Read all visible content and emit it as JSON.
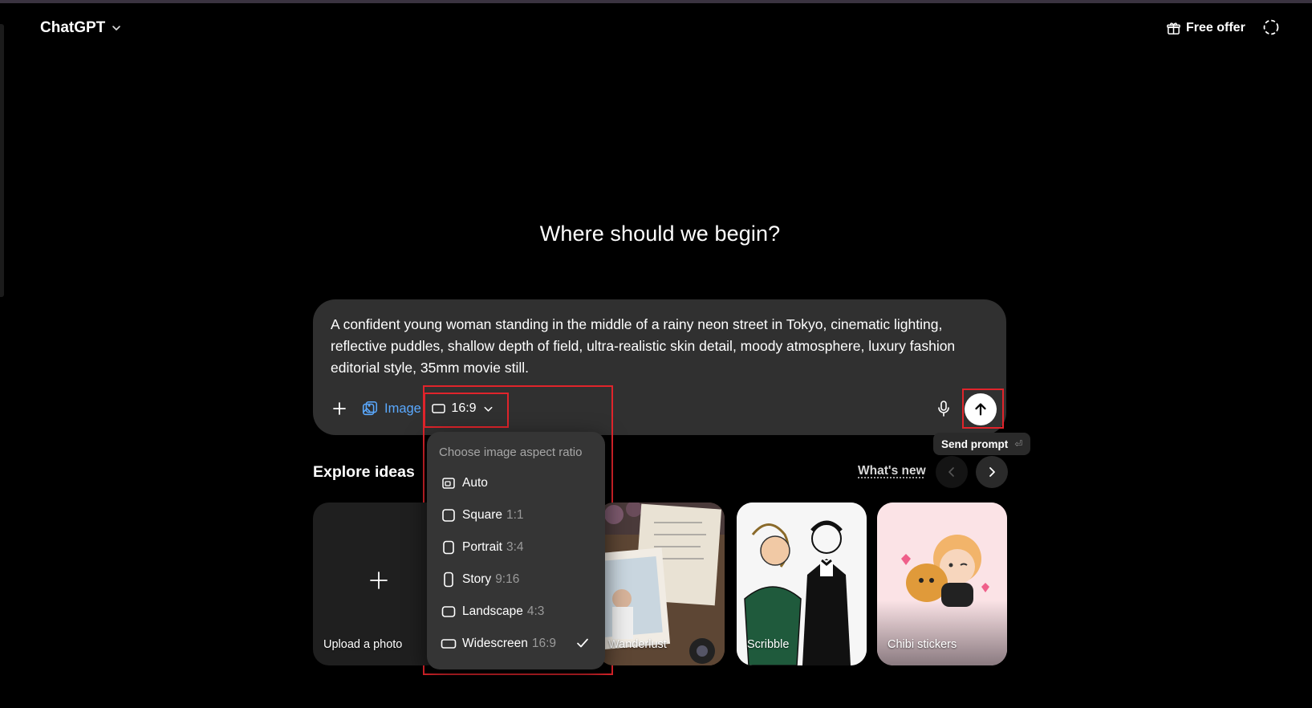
{
  "header": {
    "app_title": "ChatGPT",
    "free_offer_label": "Free offer"
  },
  "main": {
    "headline": "Where should we begin?"
  },
  "composer": {
    "prompt_text": "A confident young woman standing in the middle of a rainy neon street in Tokyo, cinematic lighting, reflective puddles, shallow depth of field, ultra-realistic skin detail, moody atmosphere, luxury fashion editorial style, 35mm movie still.",
    "image_tool_label": "Image",
    "aspect_ratio_value": "16:9"
  },
  "tooltip": {
    "label": "Send prompt",
    "shortcut": "⏎"
  },
  "explore": {
    "title": "Explore ideas",
    "whats_new": "What's new",
    "cards": [
      {
        "label": "Upload a photo"
      },
      {
        "label": "Wanderlust"
      },
      {
        "label": "Scribble"
      },
      {
        "label": "Chibi stickers"
      }
    ]
  },
  "aspect_menu": {
    "header": "Choose image aspect ratio",
    "items": [
      {
        "label": "Auto",
        "ratio": ""
      },
      {
        "label": "Square",
        "ratio": "1:1"
      },
      {
        "label": "Portrait",
        "ratio": "3:4"
      },
      {
        "label": "Story",
        "ratio": "9:16"
      },
      {
        "label": "Landscape",
        "ratio": "4:3"
      },
      {
        "label": "Widescreen",
        "ratio": "16:9",
        "selected": true
      }
    ]
  },
  "colors": {
    "accent_link": "#5aa9ff",
    "highlight_box": "#e0242b",
    "composer_bg": "#303030",
    "menu_bg": "#353535"
  }
}
